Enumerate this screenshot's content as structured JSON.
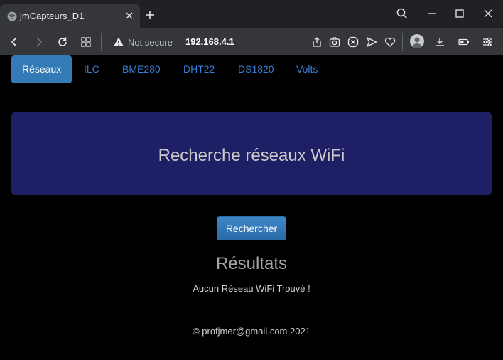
{
  "browser": {
    "tab_title": "jmCapteurs_D1",
    "security_label": "Not secure",
    "url": "192.168.4.1"
  },
  "nav": {
    "tabs": [
      {
        "label": "Réseaux"
      },
      {
        "label": "ILC"
      },
      {
        "label": "BME280"
      },
      {
        "label": "DHT22"
      },
      {
        "label": "DS1820"
      },
      {
        "label": "Volts"
      }
    ]
  },
  "main": {
    "heading": "Recherche réseaux WiFi",
    "search_button": "Rechercher",
    "results_title": "Résultats",
    "results_message": "Aucun Réseau WiFi Trouvé !"
  },
  "footer": {
    "text": "© profjmer@gmail.com 2021"
  },
  "colors": {
    "active_tab": "#337ab7",
    "tab_link": "#3a7fd6",
    "jumbotron": "#1f1f66",
    "background": "#000000"
  }
}
